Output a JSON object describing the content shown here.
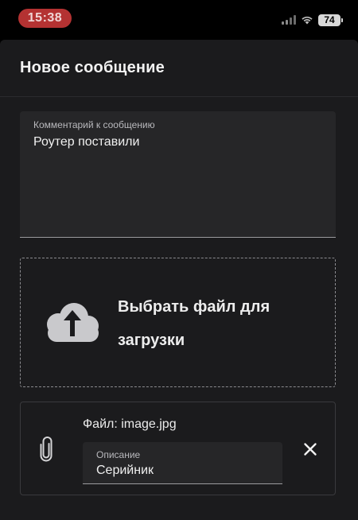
{
  "status_bar": {
    "time": "15:38",
    "battery": "74"
  },
  "dialog": {
    "title": "Новое сообщение"
  },
  "comment": {
    "label": "Комментарий к сообщению",
    "value": "Роутер поставили"
  },
  "upload": {
    "label": "Выбрать файл для загрузки"
  },
  "attachment": {
    "file_label": "Файл: image.jpg",
    "description_label": "Описание",
    "description_value": "Серийник"
  },
  "icons": {
    "upload": "cloud-upload-icon",
    "attachment": "paperclip-icon",
    "remove": "close-icon"
  },
  "colors": {
    "surface": "#1b1b1d",
    "field": "#262628",
    "time_pill": "#b43232"
  }
}
